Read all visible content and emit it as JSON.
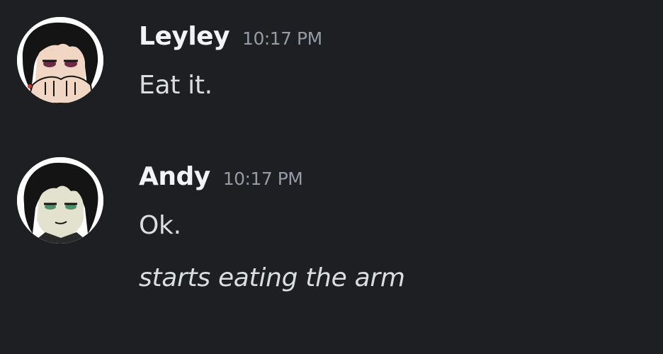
{
  "messages": [
    {
      "author": "Leyley",
      "timestamp": "10:17 PM",
      "avatar_icon": "leyley-avatar-icon",
      "lines": [
        "Eat it."
      ]
    },
    {
      "author": "Andy",
      "timestamp": "10:17 PM",
      "avatar_icon": "andy-avatar-icon",
      "lines": [
        "Ok.",
        "starts eating the arm"
      ]
    }
  ],
  "colors": {
    "background": "#1e1f22",
    "username": "#f2f3f5",
    "timestamp": "#949ba4",
    "message_text": "#dbdee1"
  }
}
